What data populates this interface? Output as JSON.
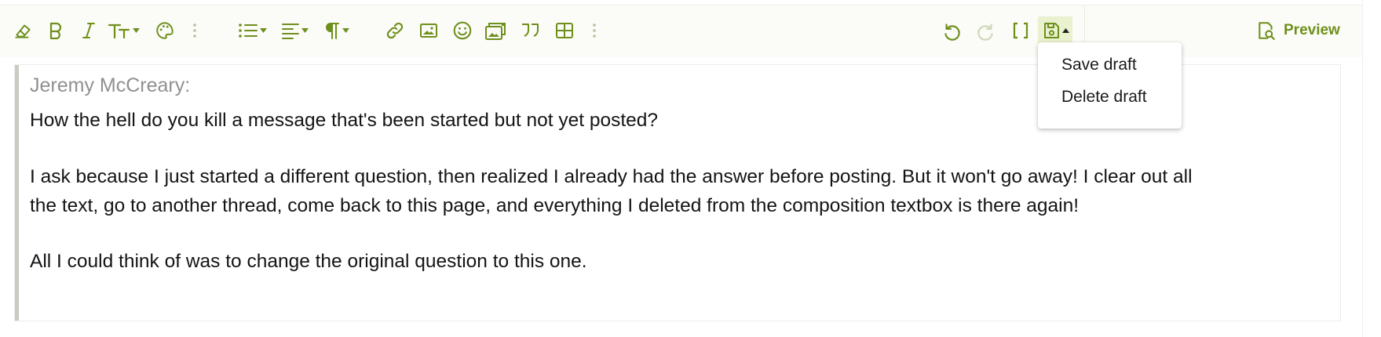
{
  "toolbar": {
    "buttons": [
      {
        "name": "clear-formatting-icon"
      },
      {
        "name": "bold-icon"
      },
      {
        "name": "italic-icon"
      },
      {
        "name": "text-size-icon"
      },
      {
        "name": "palette-icon"
      },
      {
        "name": "more-vertical-icon"
      },
      {
        "name": "bulleted-list-icon"
      },
      {
        "name": "align-icon"
      },
      {
        "name": "paragraph-icon"
      },
      {
        "name": "link-icon"
      },
      {
        "name": "image-icon"
      },
      {
        "name": "smiley-icon"
      },
      {
        "name": "media-gallery-icon"
      },
      {
        "name": "quote-icon"
      },
      {
        "name": "table-icon"
      },
      {
        "name": "more-vertical-icon"
      },
      {
        "name": "undo-icon"
      },
      {
        "name": "redo-icon",
        "disabled": true
      },
      {
        "name": "toggle-bbcode-icon"
      },
      {
        "name": "save-draft-icon",
        "active": true
      }
    ],
    "preview_label": "Preview"
  },
  "draft_menu": {
    "items": [
      "Save draft",
      "Delete draft"
    ]
  },
  "editor": {
    "quote_author": "Jeremy McCreary:",
    "paragraphs": [
      "How the hell do you kill a message that's been started but not yet posted?",
      "I ask because I just started a different question, then realized I already had the answer before posting. But it won't go away! I clear out all",
      "the text, go to another thread, come back to this page, and everything I deleted from the composition textbox is there again!",
      "All I could think of was to change the original question to this one."
    ]
  },
  "colors": {
    "accent": "#6f8f1c",
    "toolbar_bg": "#fbfcf7",
    "disabled": "#cfd8b8",
    "quote_bar": "#c9ccc3",
    "quote_author": "#8f9090"
  }
}
